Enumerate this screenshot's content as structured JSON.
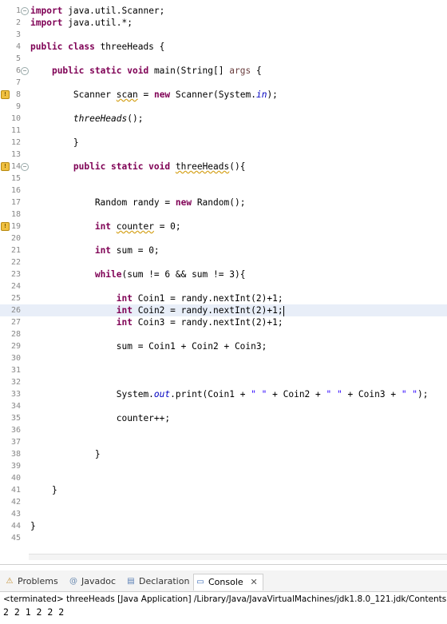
{
  "editor": {
    "lines": [
      {
        "n": "1",
        "parts": [
          [
            "kw",
            "import"
          ],
          [
            "",
            "java.util.Scanner;"
          ]
        ],
        "fold": true
      },
      {
        "n": "2",
        "parts": [
          [
            "kw",
            "import"
          ],
          [
            "",
            "java.util.*;"
          ]
        ]
      },
      {
        "n": "3",
        "parts": []
      },
      {
        "n": "4",
        "parts": [
          [
            "kw",
            "public class"
          ],
          [
            "",
            " threeHeads {"
          ]
        ]
      },
      {
        "n": "5",
        "parts": []
      },
      {
        "n": "6",
        "parts": [
          [
            "",
            "    "
          ],
          [
            "kw",
            "public static void"
          ],
          [
            "",
            " main(String[] "
          ],
          [
            "var",
            "args"
          ],
          [
            "",
            " {"
          ]
        ],
        "fold": true
      },
      {
        "n": "7",
        "parts": []
      },
      {
        "n": "8",
        "parts": [
          [
            "",
            "        Scanner "
          ],
          [
            "warn",
            "scan"
          ],
          [
            "",
            " = "
          ],
          [
            "kw",
            "new"
          ],
          [
            "",
            " Scanner(System."
          ],
          [
            "fld",
            "in"
          ],
          [
            "",
            ");"
          ]
        ],
        "marker": true
      },
      {
        "n": "9",
        "parts": []
      },
      {
        "n": "10",
        "parts": [
          [
            "",
            "        "
          ],
          [
            "it",
            "threeHeads"
          ],
          [
            "",
            "();"
          ]
        ]
      },
      {
        "n": "11",
        "parts": []
      },
      {
        "n": "12",
        "parts": [
          [
            "",
            "        }"
          ]
        ]
      },
      {
        "n": "13",
        "parts": []
      },
      {
        "n": "14",
        "parts": [
          [
            "",
            "        "
          ],
          [
            "kw",
            "public static void"
          ],
          [
            "",
            " "
          ],
          [
            "warn",
            "threeHeads"
          ],
          [
            "",
            "(){"
          ]
        ],
        "fold": true,
        "marker": true
      },
      {
        "n": "15",
        "parts": []
      },
      {
        "n": "16",
        "parts": []
      },
      {
        "n": "17",
        "parts": [
          [
            "",
            "            Random randy = "
          ],
          [
            "kw",
            "new"
          ],
          [
            "",
            " Random();"
          ]
        ]
      },
      {
        "n": "18",
        "parts": []
      },
      {
        "n": "19",
        "parts": [
          [
            "",
            "            "
          ],
          [
            "kw",
            "int"
          ],
          [
            "",
            " "
          ],
          [
            "warn",
            "counter"
          ],
          [
            "",
            " = 0;"
          ]
        ],
        "marker": true
      },
      {
        "n": "20",
        "parts": []
      },
      {
        "n": "21",
        "parts": [
          [
            "",
            "            "
          ],
          [
            "kw",
            "int"
          ],
          [
            "",
            " sum = 0;"
          ]
        ]
      },
      {
        "n": "22",
        "parts": []
      },
      {
        "n": "23",
        "parts": [
          [
            "",
            "            "
          ],
          [
            "kw",
            "while"
          ],
          [
            "",
            "(sum != 6 && sum != 3){"
          ]
        ]
      },
      {
        "n": "24",
        "parts": []
      },
      {
        "n": "25",
        "parts": [
          [
            "",
            "                "
          ],
          [
            "kw",
            "int"
          ],
          [
            "",
            " Coin1 = randy.nextInt(2)+1;"
          ]
        ]
      },
      {
        "n": "26",
        "parts": [
          [
            "",
            "                "
          ],
          [
            "kw",
            "int"
          ],
          [
            "",
            " Coin2 = randy.nextInt(2)+1;"
          ]
        ],
        "current": true
      },
      {
        "n": "27",
        "parts": [
          [
            "",
            "                "
          ],
          [
            "kw",
            "int"
          ],
          [
            "",
            " Coin3 = randy.nextInt(2)+1;"
          ]
        ]
      },
      {
        "n": "28",
        "parts": []
      },
      {
        "n": "29",
        "parts": [
          [
            "",
            "                sum = Coin1 + Coin2 + Coin3;"
          ]
        ]
      },
      {
        "n": "30",
        "parts": []
      },
      {
        "n": "31",
        "parts": []
      },
      {
        "n": "32",
        "parts": []
      },
      {
        "n": "33",
        "parts": [
          [
            "",
            "                System."
          ],
          [
            "fld",
            "out"
          ],
          [
            "",
            ".print(Coin1 + "
          ],
          [
            "str",
            "\" \""
          ],
          [
            "",
            " + Coin2 + "
          ],
          [
            "str",
            "\" \""
          ],
          [
            "",
            " + Coin3 + "
          ],
          [
            "str",
            "\" \""
          ],
          [
            "",
            ");"
          ]
        ]
      },
      {
        "n": "34",
        "parts": []
      },
      {
        "n": "35",
        "parts": [
          [
            "",
            "                counter++;"
          ]
        ]
      },
      {
        "n": "36",
        "parts": []
      },
      {
        "n": "37",
        "parts": []
      },
      {
        "n": "38",
        "parts": [
          [
            "",
            "            }"
          ]
        ]
      },
      {
        "n": "39",
        "parts": []
      },
      {
        "n": "40",
        "parts": []
      },
      {
        "n": "41",
        "parts": [
          [
            "",
            "    }"
          ]
        ]
      },
      {
        "n": "42",
        "parts": []
      },
      {
        "n": "43",
        "parts": []
      },
      {
        "n": "44",
        "parts": [
          [
            "",
            "}"
          ]
        ]
      },
      {
        "n": "45",
        "parts": []
      }
    ]
  },
  "tabs": [
    {
      "label": "Problems",
      "icon": "problems-icon",
      "glyph": "⚠",
      "color": "#c08a2a"
    },
    {
      "label": "Javadoc",
      "icon": "javadoc-icon",
      "glyph": "@",
      "color": "#6a8ab0"
    },
    {
      "label": "Declaration",
      "icon": "declaration-icon",
      "glyph": "▤",
      "color": "#5a7fb5"
    },
    {
      "label": "Console",
      "icon": "console-icon",
      "glyph": "▭",
      "color": "#3a6ab5",
      "active": true
    }
  ],
  "console": {
    "status": "<terminated> threeHeads [Java Application] /Library/Java/JavaVirtualMachines/jdk1.8.0_121.jdk/Contents",
    "output": "2 2 1 2 2 2"
  }
}
